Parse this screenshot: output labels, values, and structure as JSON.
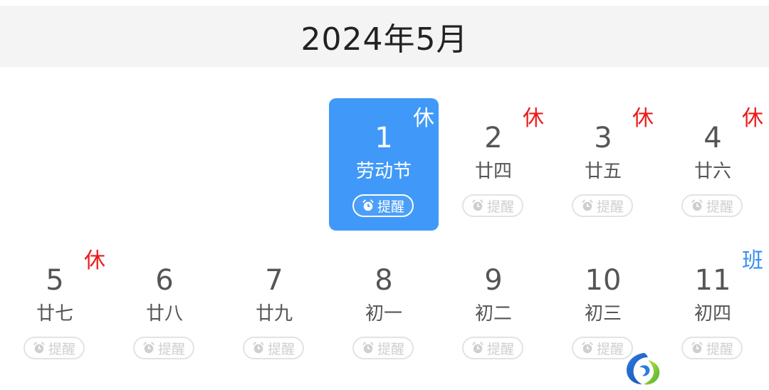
{
  "header": {
    "title": "2024年5月"
  },
  "reminder_label": "提醒",
  "week1": [
    {
      "day": "1",
      "lunar": "劳动节",
      "tag": "休",
      "tag_type": "rest",
      "selected": true
    },
    {
      "day": "2",
      "lunar": "廿四",
      "tag": "休",
      "tag_type": "rest"
    },
    {
      "day": "3",
      "lunar": "廿五",
      "tag": "休",
      "tag_type": "rest"
    },
    {
      "day": "4",
      "lunar": "廿六",
      "tag": "休",
      "tag_type": "rest"
    }
  ],
  "week2": [
    {
      "day": "5",
      "lunar": "廿七",
      "tag": "休",
      "tag_type": "rest"
    },
    {
      "day": "6",
      "lunar": "廿八"
    },
    {
      "day": "7",
      "lunar": "廿九"
    },
    {
      "day": "8",
      "lunar": "初一"
    },
    {
      "day": "9",
      "lunar": "初二"
    },
    {
      "day": "10",
      "lunar": "初三"
    },
    {
      "day": "11",
      "lunar": "初四",
      "tag": "班",
      "tag_type": "work"
    }
  ],
  "colors": {
    "selected_bg": "#4099f8",
    "rest_tag": "#ea1a1a",
    "work_tag": "#3a8ef0",
    "header_bg": "#f4f4f4"
  },
  "icons": {
    "reminder": "alarm-clock-icon",
    "watermark": "logo-icon"
  }
}
